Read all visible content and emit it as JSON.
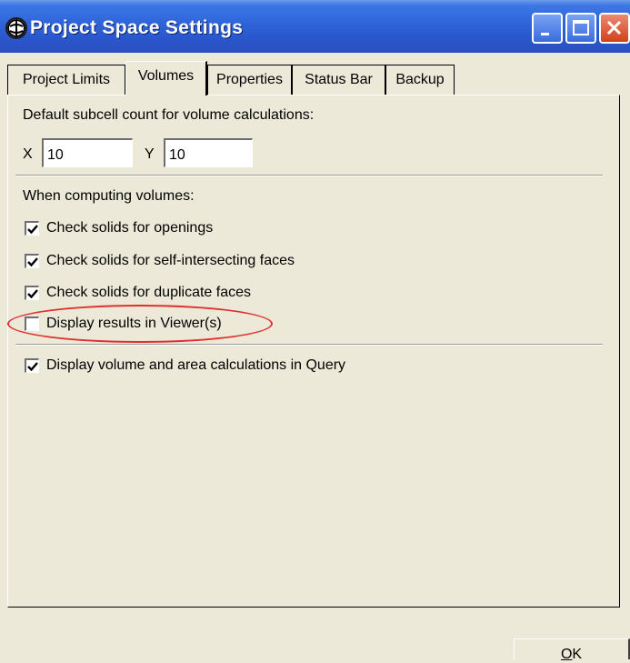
{
  "window": {
    "title": "Project Space Settings"
  },
  "tabs": [
    {
      "label": "Project Limits",
      "active": false
    },
    {
      "label": "Volumes",
      "active": true
    },
    {
      "label": "Properties",
      "active": false
    },
    {
      "label": "Status Bar",
      "active": false
    },
    {
      "label": "Backup",
      "active": false
    }
  ],
  "volumes": {
    "subcell_label": "Default subcell count for volume calculations:",
    "x_label": "X",
    "x_value": "10",
    "y_label": "Y",
    "y_value": "10",
    "computing_label": "When computing volumes:",
    "options": [
      {
        "label": "Check solids for openings",
        "checked": true
      },
      {
        "label": "Check solids for self-intersecting faces",
        "checked": true
      },
      {
        "label": "Check solids for duplicate faces",
        "checked": true
      },
      {
        "label": "Display results in Viewer(s)",
        "checked": false
      }
    ],
    "query_option": {
      "label": "Display volume and area calculations in Query",
      "checked": true
    }
  },
  "buttons": {
    "ok_label": "OK",
    "ok_accel": "O",
    "ok_rest": "K"
  },
  "colors": {
    "titlebar": "#2a56cc",
    "annotation_ellipse": "#e03030",
    "dialog_bg": "#ece9d8"
  }
}
